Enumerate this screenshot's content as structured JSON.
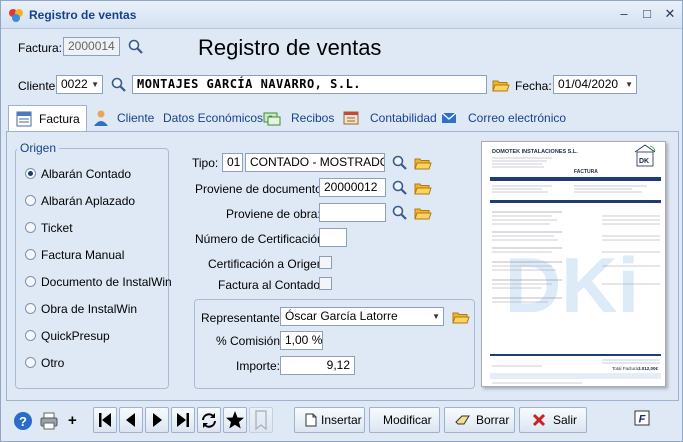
{
  "window": {
    "title": "Registro de ventas",
    "controls": [
      "–",
      "□",
      "✕"
    ]
  },
  "header": {
    "invoice_label": "Factura:",
    "invoice_number": "2000014",
    "big_title": "Registro de ventas",
    "client_label": "Cliente:",
    "client_code": "0022",
    "client_name": "MONTAJES GARCÍA NAVARRO, S.L.",
    "date_label": "Fecha:",
    "date_value": "01/04/2020"
  },
  "tabs": [
    {
      "label": "Factura",
      "active": true
    },
    {
      "label": "Cliente"
    },
    {
      "label": "Datos Económicos"
    },
    {
      "label": "Recibos"
    },
    {
      "label": "Contabilidad"
    },
    {
      "label": "Correo electrónico"
    }
  ],
  "origen": {
    "title": "Origen",
    "options": [
      "Albarán Contado",
      "Albarán Aplazado",
      "Ticket",
      "Factura Manual",
      "Documento de InstalWin",
      "Obra de InstalWin",
      "QuickPresup",
      "Otro"
    ],
    "selected": 0
  },
  "form": {
    "tipo_label": "Tipo:",
    "tipo_code": "01",
    "tipo_value": "CONTADO - MOSTRADOR",
    "doc_label": "Proviene de documento:",
    "doc_value": "20000012",
    "obra_label": "Proviene de obra:",
    "obra_value": "",
    "cert_label": "Número de Certificación:",
    "cert_value": "",
    "cert_origen_label": "Certificación a Origen:",
    "contado_label": "Factura al  Contado:",
    "rep_label": "Representante:",
    "rep_value": "Óscar García Latorre",
    "comision_label": "% Comisión:",
    "comision_value": "1,00 %",
    "importe_label": "Importe:",
    "importe_value": "9,12"
  },
  "preview": {
    "company": "DOMOTEK INSTALACIONES S.L.",
    "doc_type": "FACTURA",
    "watermark": "DKi",
    "total_label": "Total Factura",
    "total_value": "3.012,00€"
  },
  "bottom": {
    "plus": "+",
    "insert_label": "Insertar",
    "modify_label": "Modificar",
    "delete_label": "Borrar",
    "exit_label": "Salir"
  },
  "colors": {
    "accent": "#15428b",
    "window_bg": "#dfe9f5"
  }
}
